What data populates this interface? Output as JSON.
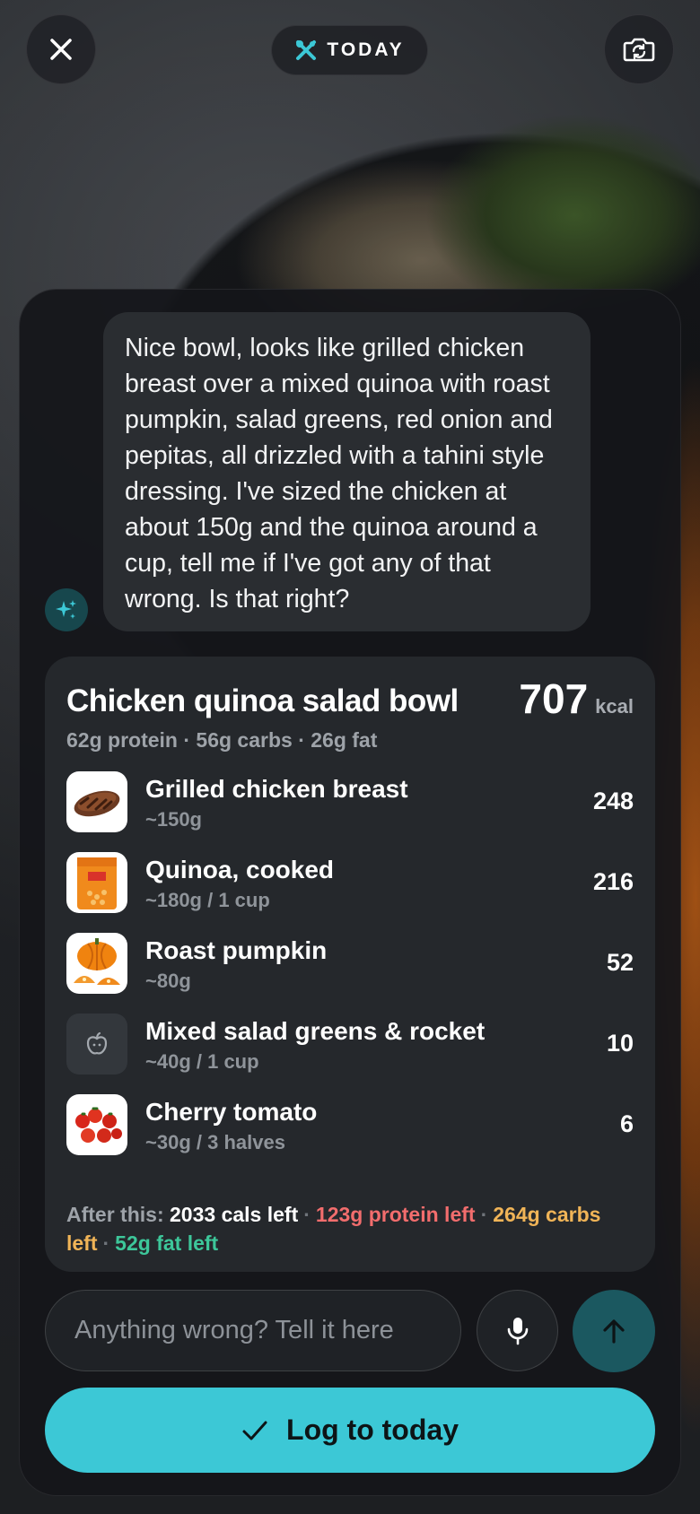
{
  "header": {
    "close_icon": "close-icon",
    "today_label": "TODAY",
    "today_icon": "fork-knife-cross-icon",
    "camera_icon": "camera-switch-icon"
  },
  "assistant": {
    "icon": "sparkles-icon",
    "message": "Nice bowl, looks like grilled chicken breast over a mixed quinoa with roast pumpkin, salad greens, red onion and pepitas, all drizzled with a tahini style dressing. I've sized the chicken at about 150g and the quinoa around a cup, tell me if I've got any of that wrong. Is that right?"
  },
  "meal": {
    "title": "Chicken quinoa salad bowl",
    "kcal_value": "707",
    "kcal_unit": "kcal",
    "macros": "62g protein · 56g carbs · 26g fat",
    "items": [
      {
        "name": "Grilled chicken breast",
        "portion": "~150g",
        "cals": "248",
        "thumb": "chicken-thumbnail"
      },
      {
        "name": "Quinoa, cooked",
        "portion": "~180g / 1 cup",
        "cals": "216",
        "thumb": "quinoa-package-thumbnail"
      },
      {
        "name": "Roast pumpkin",
        "portion": "~80g",
        "cals": "52",
        "thumb": "pumpkin-thumbnail"
      },
      {
        "name": "Mixed salad greens & rocket",
        "portion": "~40g / 1 cup",
        "cals": "10",
        "thumb": "apple-icon"
      },
      {
        "name": "Cherry tomato",
        "portion": "~30g / 3 halves",
        "cals": "6",
        "thumb": "tomato-thumbnail"
      }
    ]
  },
  "summary": {
    "prefix": "After this:",
    "cals_left": "2033 cals left",
    "protein_left": "123g protein left",
    "carbs_left": "264g carbs left",
    "fat_left": "52g fat left",
    "colors": {
      "protein": "#f26d6d",
      "carbs": "#f0b457",
      "fat": "#3dc79a"
    }
  },
  "composer": {
    "placeholder": "Anything wrong? Tell it here",
    "value": "",
    "mic_icon": "microphone-icon",
    "send_icon": "arrow-up-icon"
  },
  "log_button": {
    "label": "Log to today",
    "icon": "checkmark-icon",
    "color": "#3cc8d6"
  }
}
